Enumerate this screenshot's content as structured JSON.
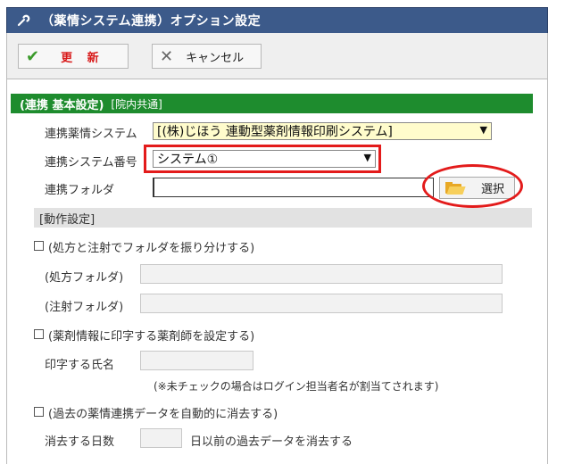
{
  "window": {
    "title": "（薬情システム連携）オプション設定",
    "title_icon": "wrench-icon"
  },
  "toolbar": {
    "update_label": "更 新",
    "update_icon": "checkmark-icon",
    "cancel_label": "キャンセル",
    "cancel_icon": "x-icon"
  },
  "section": {
    "title": "(連携 基本設定)",
    "subtitle": "[院内共通]",
    "color": "#1e8c2e"
  },
  "form": {
    "system_label": "連携薬情システム",
    "system_value": "[(株)じほう 連動型薬剤情報印刷システム]",
    "number_label": "連携システム番号",
    "number_value": "システム①",
    "folder_label": "連携フォルダ",
    "folder_value": "",
    "select_button": "選択",
    "select_icon": "folder-icon"
  },
  "behavior": {
    "header": "[動作設定]",
    "split_folder": {
      "checkbox_label": "(処方と注射でフォルダを振り分けする)",
      "checked": false,
      "rx_folder_label": "(処方フォルダ)",
      "rx_folder_value": "",
      "inj_folder_label": "(注射フォルダ)",
      "inj_folder_value": ""
    },
    "pharmacist": {
      "checkbox_label": "(薬剤情報に印字する薬剤師を設定する)",
      "checked": false,
      "name_label": "印字する氏名",
      "name_value": "",
      "note": "(※未チェックの場合はログイン担当者名が割当てされます)"
    },
    "auto_delete": {
      "checkbox_label": "(過去の薬情連携データを自動的に消去する)",
      "checked": false,
      "days_label": "消去する日数",
      "days_value": "",
      "days_suffix": "日以前の過去データを消去する"
    }
  },
  "accent": {
    "highlight_red": "#e31b1b",
    "titlebar": "#3c5a8a"
  }
}
